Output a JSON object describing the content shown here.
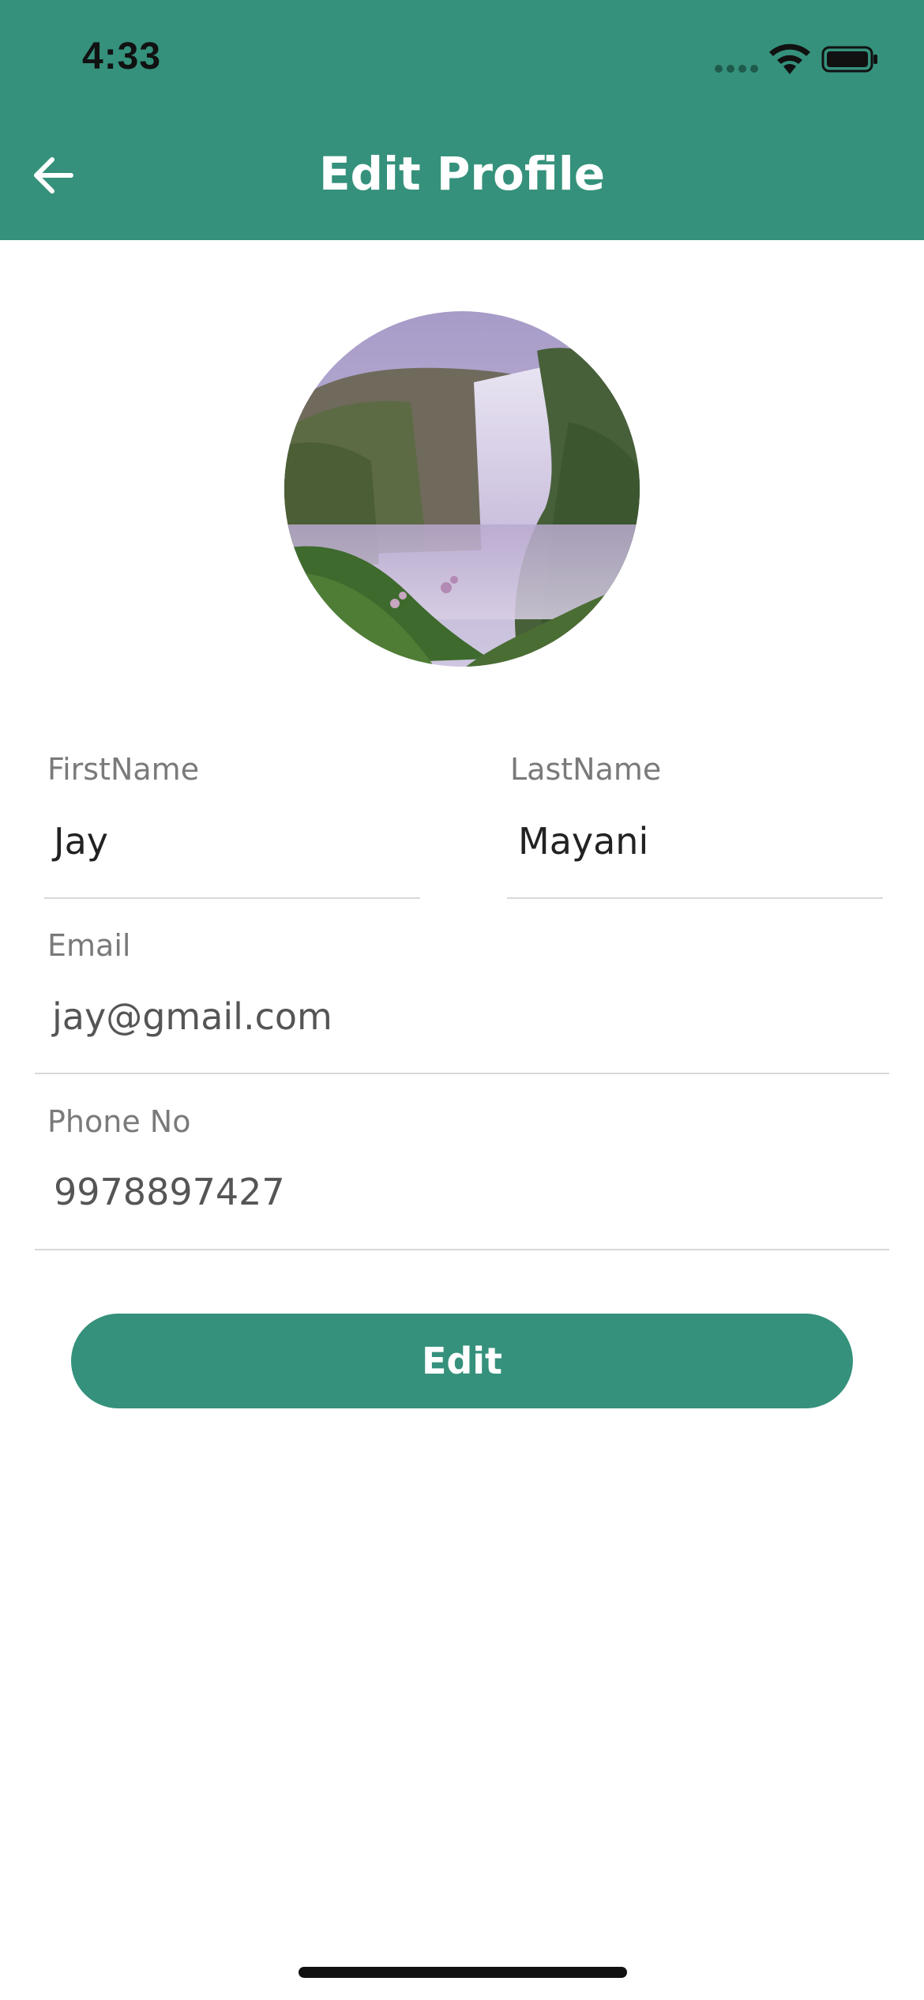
{
  "status_bar": {
    "time": "4:33"
  },
  "header": {
    "title": "Edit Profile",
    "back_icon": "arrow-left-icon"
  },
  "profile": {
    "avatar": "waterfall-photo"
  },
  "form": {
    "first_name": {
      "label": "FirstName",
      "value": "Jay"
    },
    "last_name": {
      "label": "LastName",
      "value": "Mayani"
    },
    "email": {
      "label": "Email",
      "value": "jay@gmail.com"
    },
    "phone": {
      "label": "Phone No",
      "value": "9978897427"
    }
  },
  "actions": {
    "edit_label": "Edit"
  },
  "colors": {
    "primary": "#35917b",
    "background": "#ffffff",
    "divider": "#d8d8d8"
  }
}
